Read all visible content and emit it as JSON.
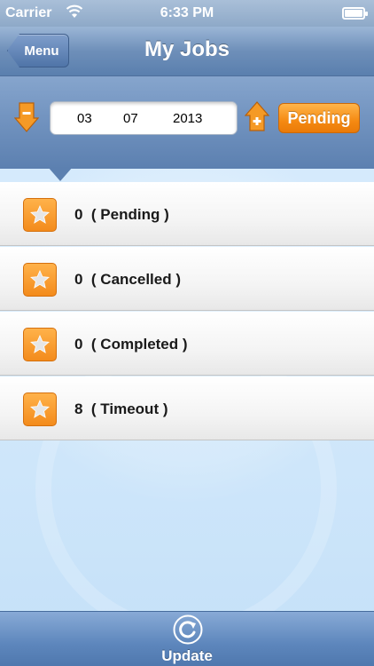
{
  "status_bar": {
    "carrier": "Carrier",
    "time": "6:33 PM",
    "wifi_icon": "wifi-icon",
    "battery_icon": "battery-icon"
  },
  "nav": {
    "back_label": "Menu",
    "title": "My Jobs"
  },
  "date_filter": {
    "day": "03",
    "month": "07",
    "year": "2013",
    "decrement_icon": "arrow-down-minus-icon",
    "increment_icon": "arrow-up-plus-icon",
    "status_button": "Pending"
  },
  "jobs": [
    {
      "count": "0",
      "status": "( Pending )",
      "icon": "star-icon"
    },
    {
      "count": "0",
      "status": "( Cancelled )",
      "icon": "star-icon"
    },
    {
      "count": "0",
      "status": "( Completed )",
      "icon": "star-icon"
    },
    {
      "count": "8",
      "status": "( Timeout )",
      "icon": "star-icon"
    }
  ],
  "footer": {
    "update_label": "Update",
    "update_icon": "refresh-icon"
  },
  "colors": {
    "accent_orange": "#f58a12",
    "nav_blue": "#6e8fb9"
  }
}
